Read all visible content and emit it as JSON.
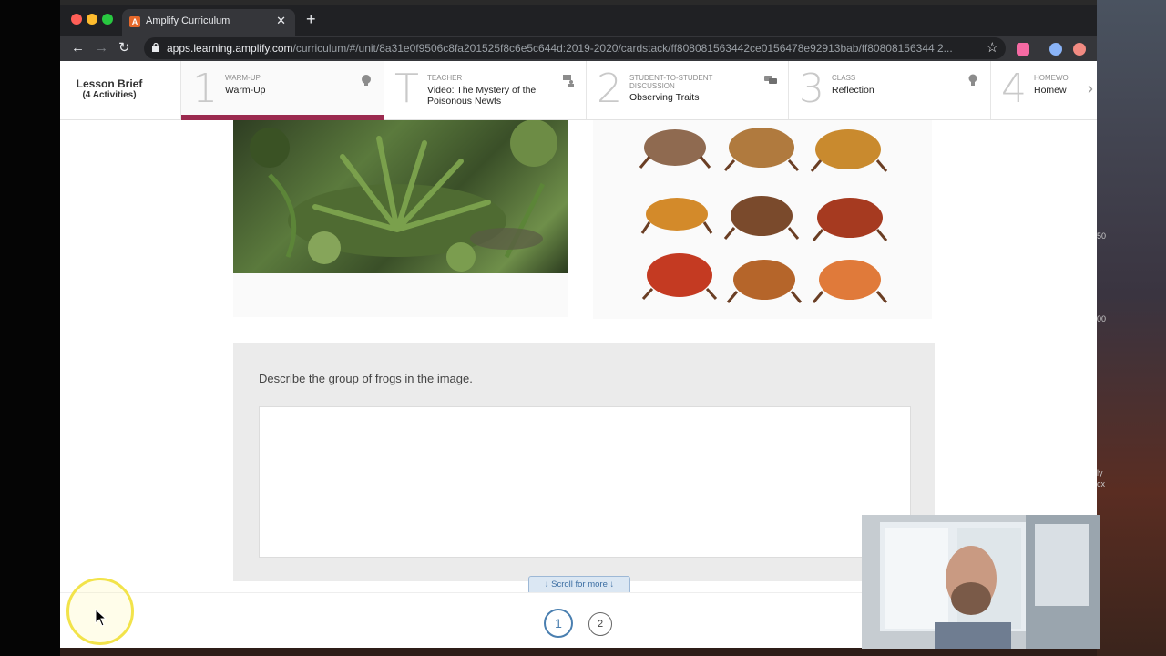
{
  "browser": {
    "tab_title": "Amplify Curriculum",
    "tab_favicon_letter": "A",
    "new_tab_icon": "plus-icon",
    "url_host": "apps.learning.amplify.com",
    "url_path": "/curriculum/#/unit/8a31e0f9506c8fa201525f8c6e5c644d:2019-2020/cardstack/ff808081563442ce0156478e92913bab/ff80808156344 2..."
  },
  "lesson_nav": {
    "brief_title": "Lesson Brief",
    "brief_sub": "(4 Activities)",
    "activities": [
      {
        "num": "1",
        "type": "WARM-UP",
        "name": "Warm-Up",
        "icon": "head-icon"
      },
      {
        "num": "T",
        "type": "TEACHER",
        "name": "Video: The Mystery of the Poisonous Newts",
        "icon": "presenter-icon"
      },
      {
        "num": "2",
        "type": "STUDENT-TO-STUDENT DISCUSSION",
        "name": "Observing Traits",
        "icon": "chat-icon"
      },
      {
        "num": "3",
        "type": "CLASS",
        "name": "Reflection",
        "icon": "lightbulb-icon"
      },
      {
        "num": "4",
        "type": "HOMEWO",
        "name": "Homew",
        "icon": ""
      }
    ]
  },
  "content": {
    "question": "Describe the group of frogs in the image.",
    "answer_value": "",
    "scroll_label": "Scroll for more",
    "pages": [
      "1",
      "2"
    ],
    "current_page": "1"
  },
  "desktop": {
    "fragments": [
      "50",
      "00",
      "ly",
      "cx"
    ]
  },
  "colors": {
    "accent": "#9b2a4f",
    "pagination": "#4a7fb0"
  }
}
